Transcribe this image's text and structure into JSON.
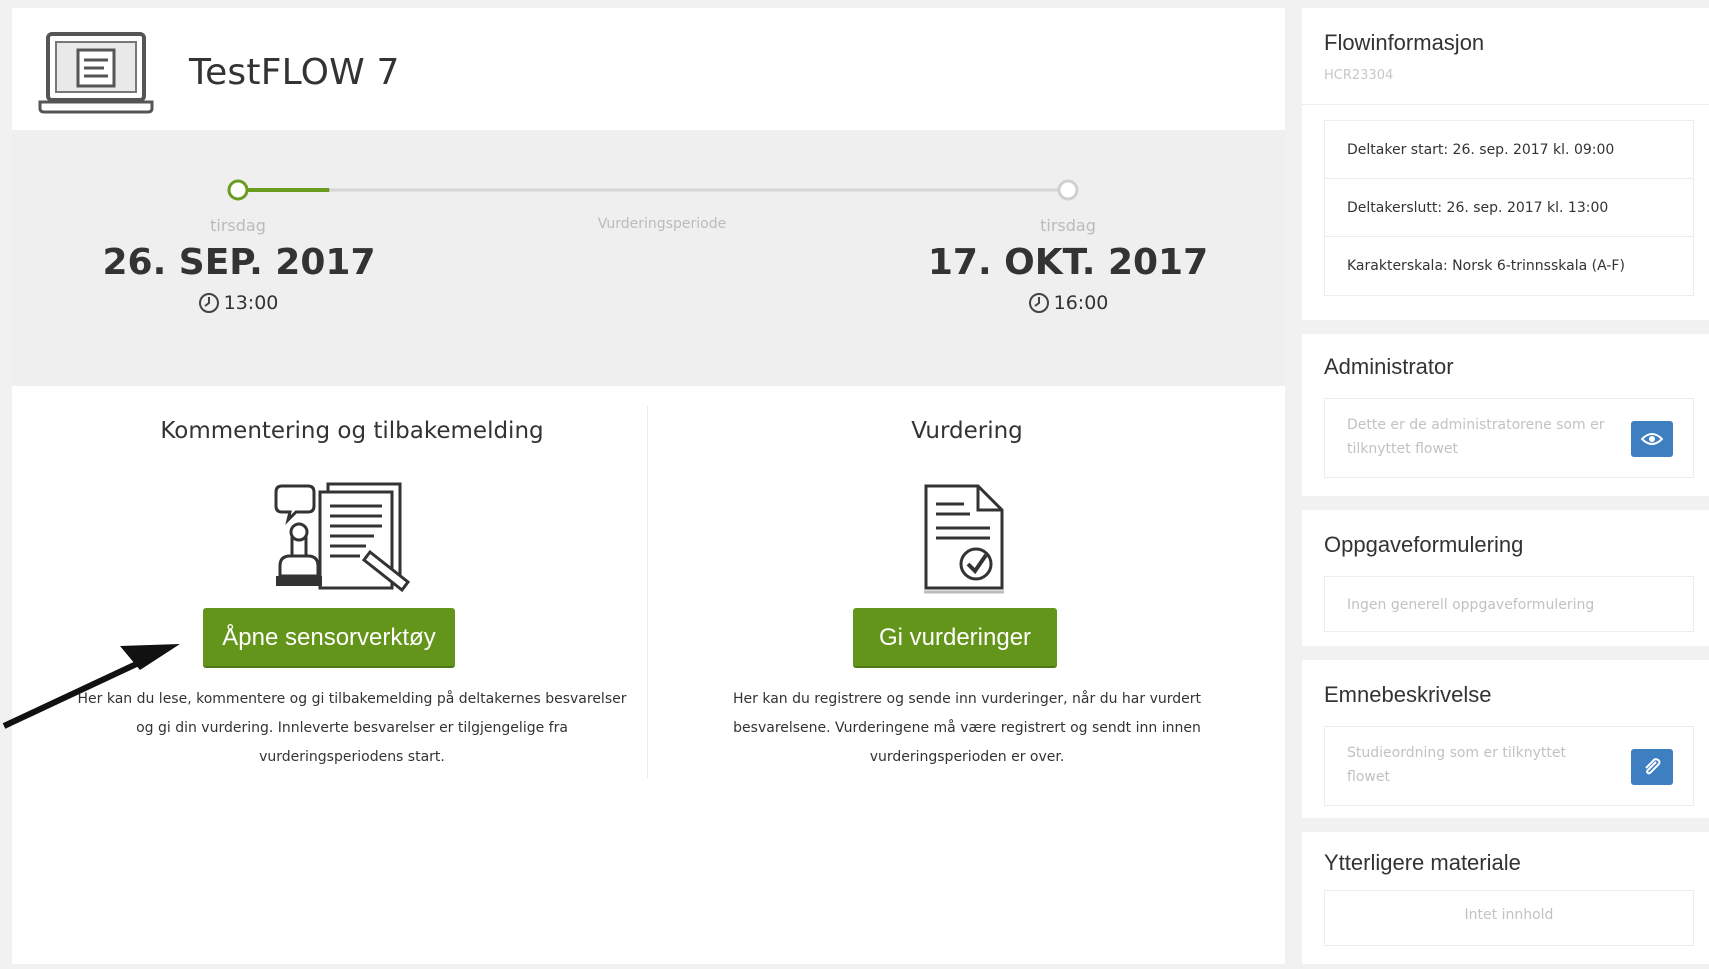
{
  "header": {
    "title": "TestFLOW 7"
  },
  "timeline": {
    "period_label": "Vurderingsperiode",
    "progress": 0.11,
    "start": {
      "day": "tirsdag",
      "date": "26. SEP. 2017",
      "time": "13:00"
    },
    "end": {
      "day": "tirsdag",
      "date": "17. OKT. 2017",
      "time": "16:00"
    }
  },
  "columns": {
    "feedback": {
      "title": "Kommentering og tilbakemelding",
      "button": "Åpne sensorverktøy",
      "desc1": "Her kan du lese, kommentere og gi tilbakemelding på deltakernes besvarelser",
      "desc2": "og gi din vurdering. Innleverte besvarelser er tilgjengelige fra",
      "desc3": "vurderingsperiodens start."
    },
    "grading": {
      "title": "Vurdering",
      "button": "Gi vurderinger",
      "desc1": "Her kan du registrere og sende inn vurderinger, når du har vurdert",
      "desc2": "besvarelsene. Vurderingene må være registrert og sendt inn innen",
      "desc3": "vurderingsperioden er over."
    }
  },
  "sidebar": {
    "flowinfo": {
      "title": "Flowinformasjon",
      "code": "HCR23304",
      "rows": [
        "Deltaker start: 26. sep. 2017 kl. 09:00",
        "Deltakerslutt: 26. sep. 2017 kl. 13:00",
        "Karakterskala: Norsk 6-trinnsskala (A-F)"
      ]
    },
    "admin": {
      "title": "Administrator",
      "text1": "Dette er de administratorene som er",
      "text2": "tilknyttet flowet"
    },
    "task": {
      "title": "Oppgaveformulering",
      "text": "Ingen generell oppgaveformulering"
    },
    "subject": {
      "title": "Emnebeskrivelse",
      "text1": "Studieordning som er tilknyttet",
      "text2": "flowet"
    },
    "extra": {
      "title": "Ytterligere materiale",
      "text": "Intet innhold"
    }
  },
  "colors": {
    "accent": "#63951a",
    "button_blue": "#3d7fc1"
  }
}
